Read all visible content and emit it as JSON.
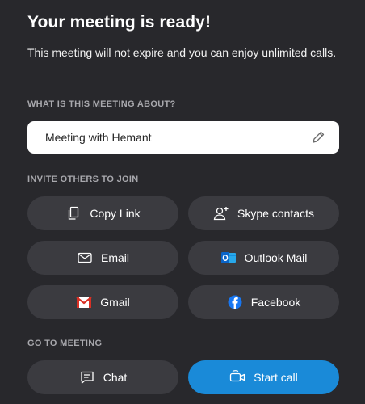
{
  "header": {
    "title": "Your meeting is ready!",
    "subtitle": "This meeting will not expire and you can enjoy unlimited calls."
  },
  "about": {
    "label": "WHAT IS THIS MEETING ABOUT?",
    "value": "Meeting with Hemant",
    "edit_icon": "pencil-icon"
  },
  "invite": {
    "label": "INVITE OTHERS TO JOIN",
    "buttons": [
      {
        "label": "Copy Link",
        "icon": "copy-icon"
      },
      {
        "label": "Skype contacts",
        "icon": "add-person-icon"
      },
      {
        "label": "Email",
        "icon": "envelope-icon"
      },
      {
        "label": "Outlook Mail",
        "icon": "outlook-icon"
      },
      {
        "label": "Gmail",
        "icon": "gmail-icon"
      },
      {
        "label": "Facebook",
        "icon": "facebook-icon"
      }
    ]
  },
  "goto": {
    "label": "GO TO MEETING",
    "chat_label": "Chat",
    "start_label": "Start call"
  },
  "colors": {
    "background": "#28282c",
    "button": "#3b3b40",
    "primary": "#1a8ad8",
    "outlook_blue": "#0a64c8",
    "gmail_red": "#d93025",
    "facebook_blue": "#1877f2"
  }
}
